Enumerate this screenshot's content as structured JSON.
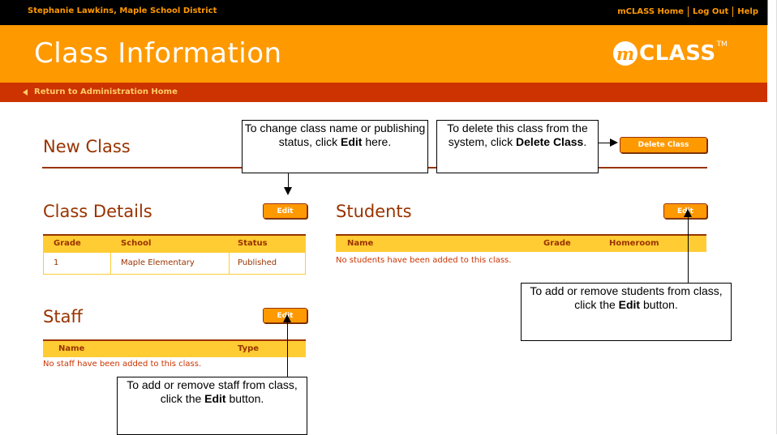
{
  "topbar": {
    "user": "Stephanie Lawkins, Maple School District",
    "nav": [
      "mCLASS Home",
      "Log Out",
      "Help"
    ]
  },
  "header": {
    "title": "Class Information",
    "logo_mark": "m",
    "logo_text": "CLASS",
    "logo_tm": "TM"
  },
  "return_link": "Return to Administration Home",
  "class_name": "New Class",
  "delete_button": "Delete Class",
  "class_details": {
    "heading": "Class Details",
    "edit": "Edit",
    "columns": [
      "Grade",
      "School",
      "Status"
    ],
    "row": [
      "1",
      "Maple Elementary",
      "Published"
    ]
  },
  "students": {
    "heading": "Students",
    "edit": "Edit",
    "columns": [
      "Name",
      "Grade",
      "Homeroom"
    ],
    "empty": "No students have been added to this class."
  },
  "staff": {
    "heading": "Staff",
    "edit": "Edit",
    "columns": [
      "Name",
      "Type"
    ],
    "empty": "No staff have been added to this class."
  },
  "callouts": {
    "edit_class": {
      "pre": "To change class name or publishing status, click ",
      "bold": "Edit",
      "post": " here."
    },
    "delete_class": {
      "pre": "To delete this class from the system, click ",
      "bold": "Delete Class",
      "post": "."
    },
    "students": {
      "pre": "To add or remove students from class, click the ",
      "bold": "Edit",
      "post": " button."
    },
    "staff": {
      "pre": "To add or remove staff from class, click the ",
      "bold": "Edit",
      "post": " button."
    }
  },
  "colors": {
    "orange": "#ff9900",
    "rust": "#993300",
    "red": "#cc3300",
    "yellow": "#ffcc33"
  }
}
